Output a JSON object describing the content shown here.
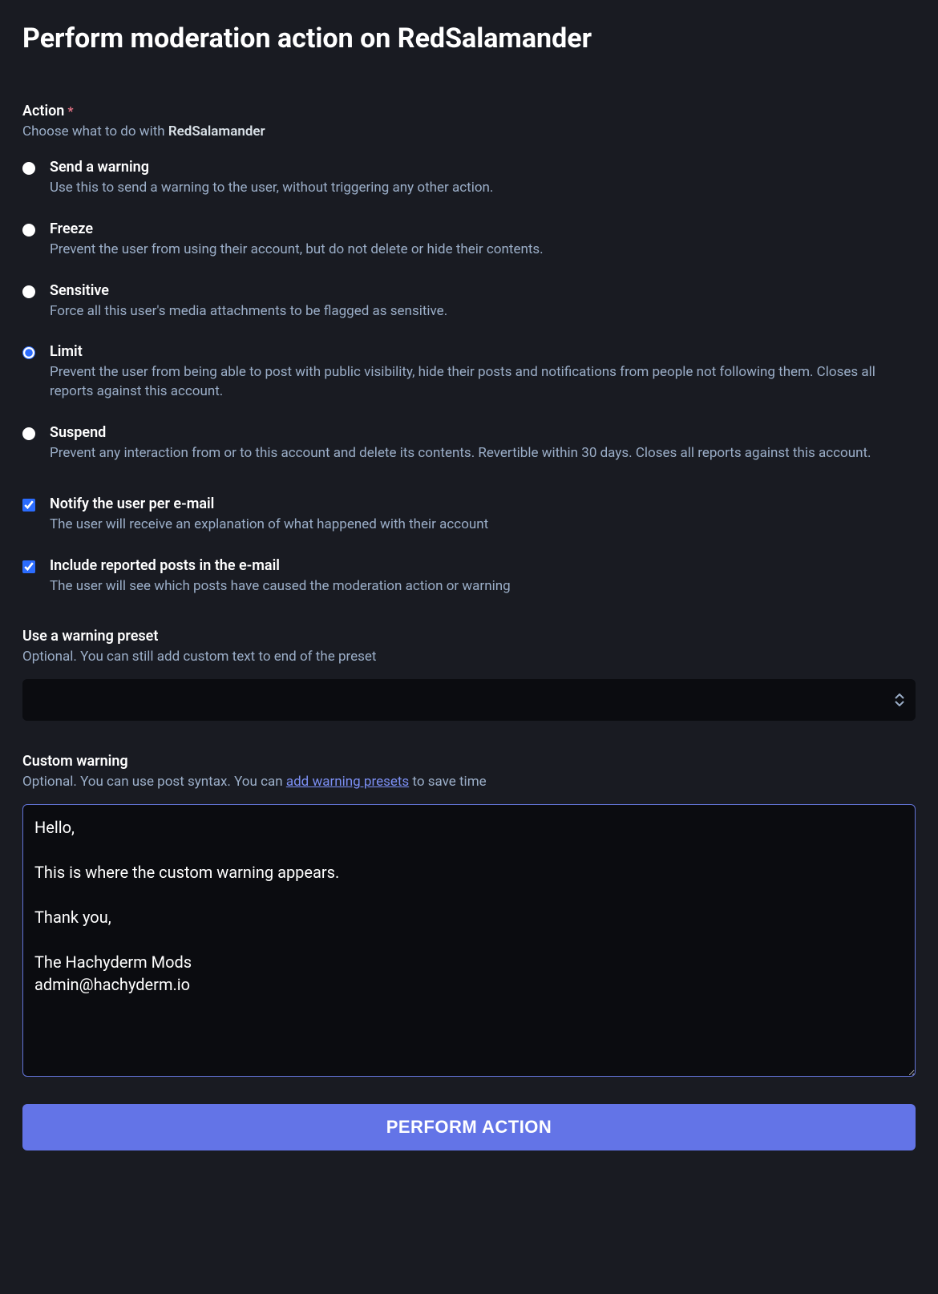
{
  "page_title": "Perform moderation action on RedSalamander",
  "username": "RedSalamander",
  "action_section": {
    "label": "Action",
    "required_mark": "*",
    "hint_prefix": "Choose what to do with ",
    "options": [
      {
        "id": "warning",
        "label": "Send a warning",
        "desc": "Use this to send a warning to the user, without triggering any other action.",
        "checked": false
      },
      {
        "id": "freeze",
        "label": "Freeze",
        "desc": "Prevent the user from using their account, but do not delete or hide their contents.",
        "checked": false
      },
      {
        "id": "sensitive",
        "label": "Sensitive",
        "desc": "Force all this user's media attachments to be flagged as sensitive.",
        "checked": false
      },
      {
        "id": "limit",
        "label": "Limit",
        "desc": "Prevent the user from being able to post with public visibility, hide their posts and notifications from people not following them. Closes all reports against this account.",
        "checked": true
      },
      {
        "id": "suspend",
        "label": "Suspend",
        "desc": "Prevent any interaction from or to this account and delete its contents. Revertible within 30 days. Closes all reports against this account.",
        "checked": false
      }
    ]
  },
  "notify": {
    "label": "Notify the user per e-mail",
    "desc": "The user will receive an explanation of what happened with their account",
    "checked": true
  },
  "include_posts": {
    "label": "Include reported posts in the e-mail",
    "desc": "The user will see which posts have caused the moderation action or warning",
    "checked": true
  },
  "preset": {
    "label": "Use a warning preset",
    "hint": "Optional. You can still add custom text to end of the preset",
    "value": ""
  },
  "custom": {
    "label": "Custom warning",
    "hint_prefix": "Optional. You can use post syntax. You can ",
    "hint_link": "add warning presets",
    "hint_suffix": " to save time",
    "value": "Hello,\n\nThis is where the custom warning appears.\n\nThank you,\n\nThe Hachyderm Mods\nadmin@hachyderm.io"
  },
  "submit_label": "Perform Action"
}
